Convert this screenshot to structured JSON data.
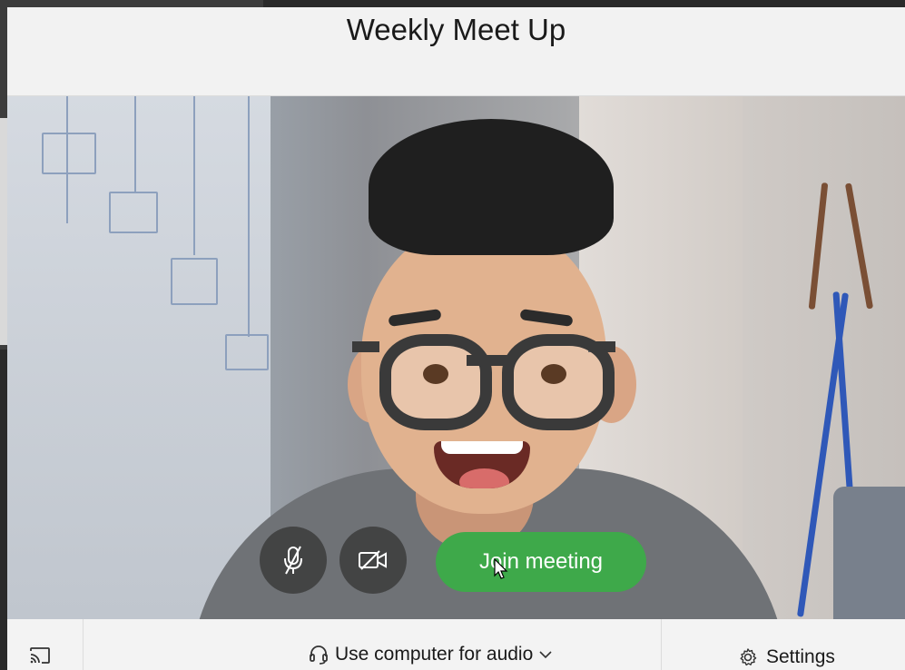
{
  "window": {
    "title": "Weekly Meet Up"
  },
  "controls": {
    "mute_icon": "mic-off-icon",
    "video_icon": "video-off-icon",
    "join_label": "Join meeting",
    "join_color": "#3ea94a"
  },
  "bottom_bar": {
    "cast_icon": "cast-icon",
    "audio_label": "Use computer for audio",
    "audio_icon": "headset-icon",
    "audio_chevron": "chevron-down-icon",
    "settings_label": "Settings",
    "settings_icon": "gear-icon"
  }
}
